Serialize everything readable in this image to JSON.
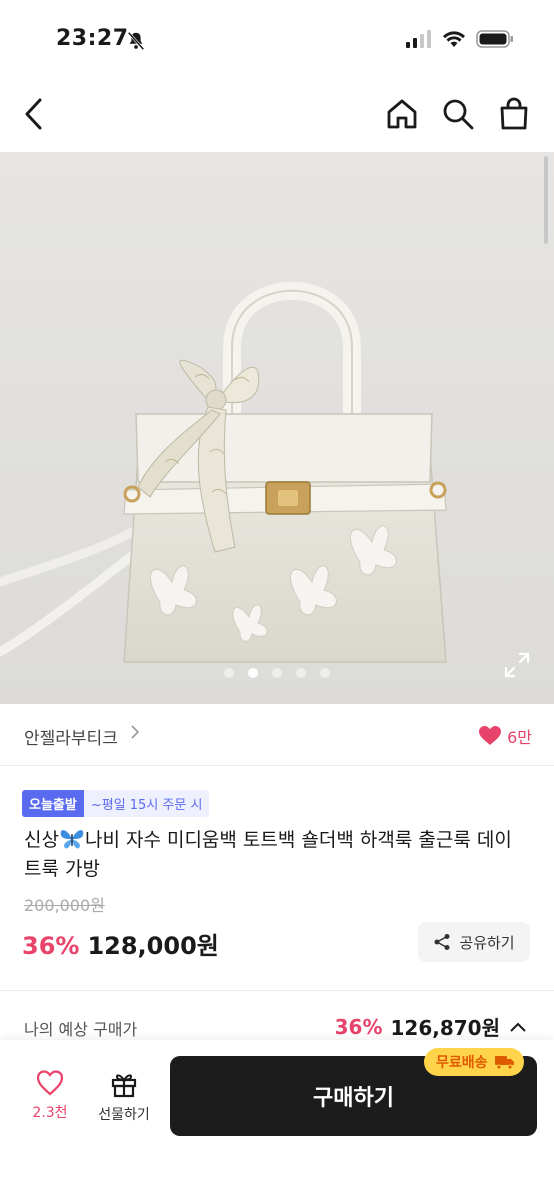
{
  "status": {
    "time": "23:27"
  },
  "product": {
    "brand": "안젤라부티크",
    "likes": "6만",
    "badge_today": "오늘출발",
    "badge_order": "~평일 15시 주문 시",
    "title_prefix": "신상",
    "title_rest": "나비 자수 미디움백 토트백 숄더백 하객룩 출근룩 데이트룩 가방",
    "original_price": "200,000원",
    "discount": "36%",
    "price": "128,000원",
    "image_count": 5,
    "image_active_index": 1
  },
  "actions": {
    "share_label": "공유하기"
  },
  "expected": {
    "label": "나의 예상 구매가",
    "discount": "36%",
    "price": "126,870원"
  },
  "bottom": {
    "wish_count": "2.3천",
    "gift_label": "선물하기",
    "buy_label": "구매하기",
    "free_shipping": "무료배송"
  },
  "colors": {
    "accent_pink": "#e8436a",
    "badge_blue": "#5a6bf0",
    "button_dark": "#1c1c1c",
    "ship_yellow": "#ffd44a"
  }
}
